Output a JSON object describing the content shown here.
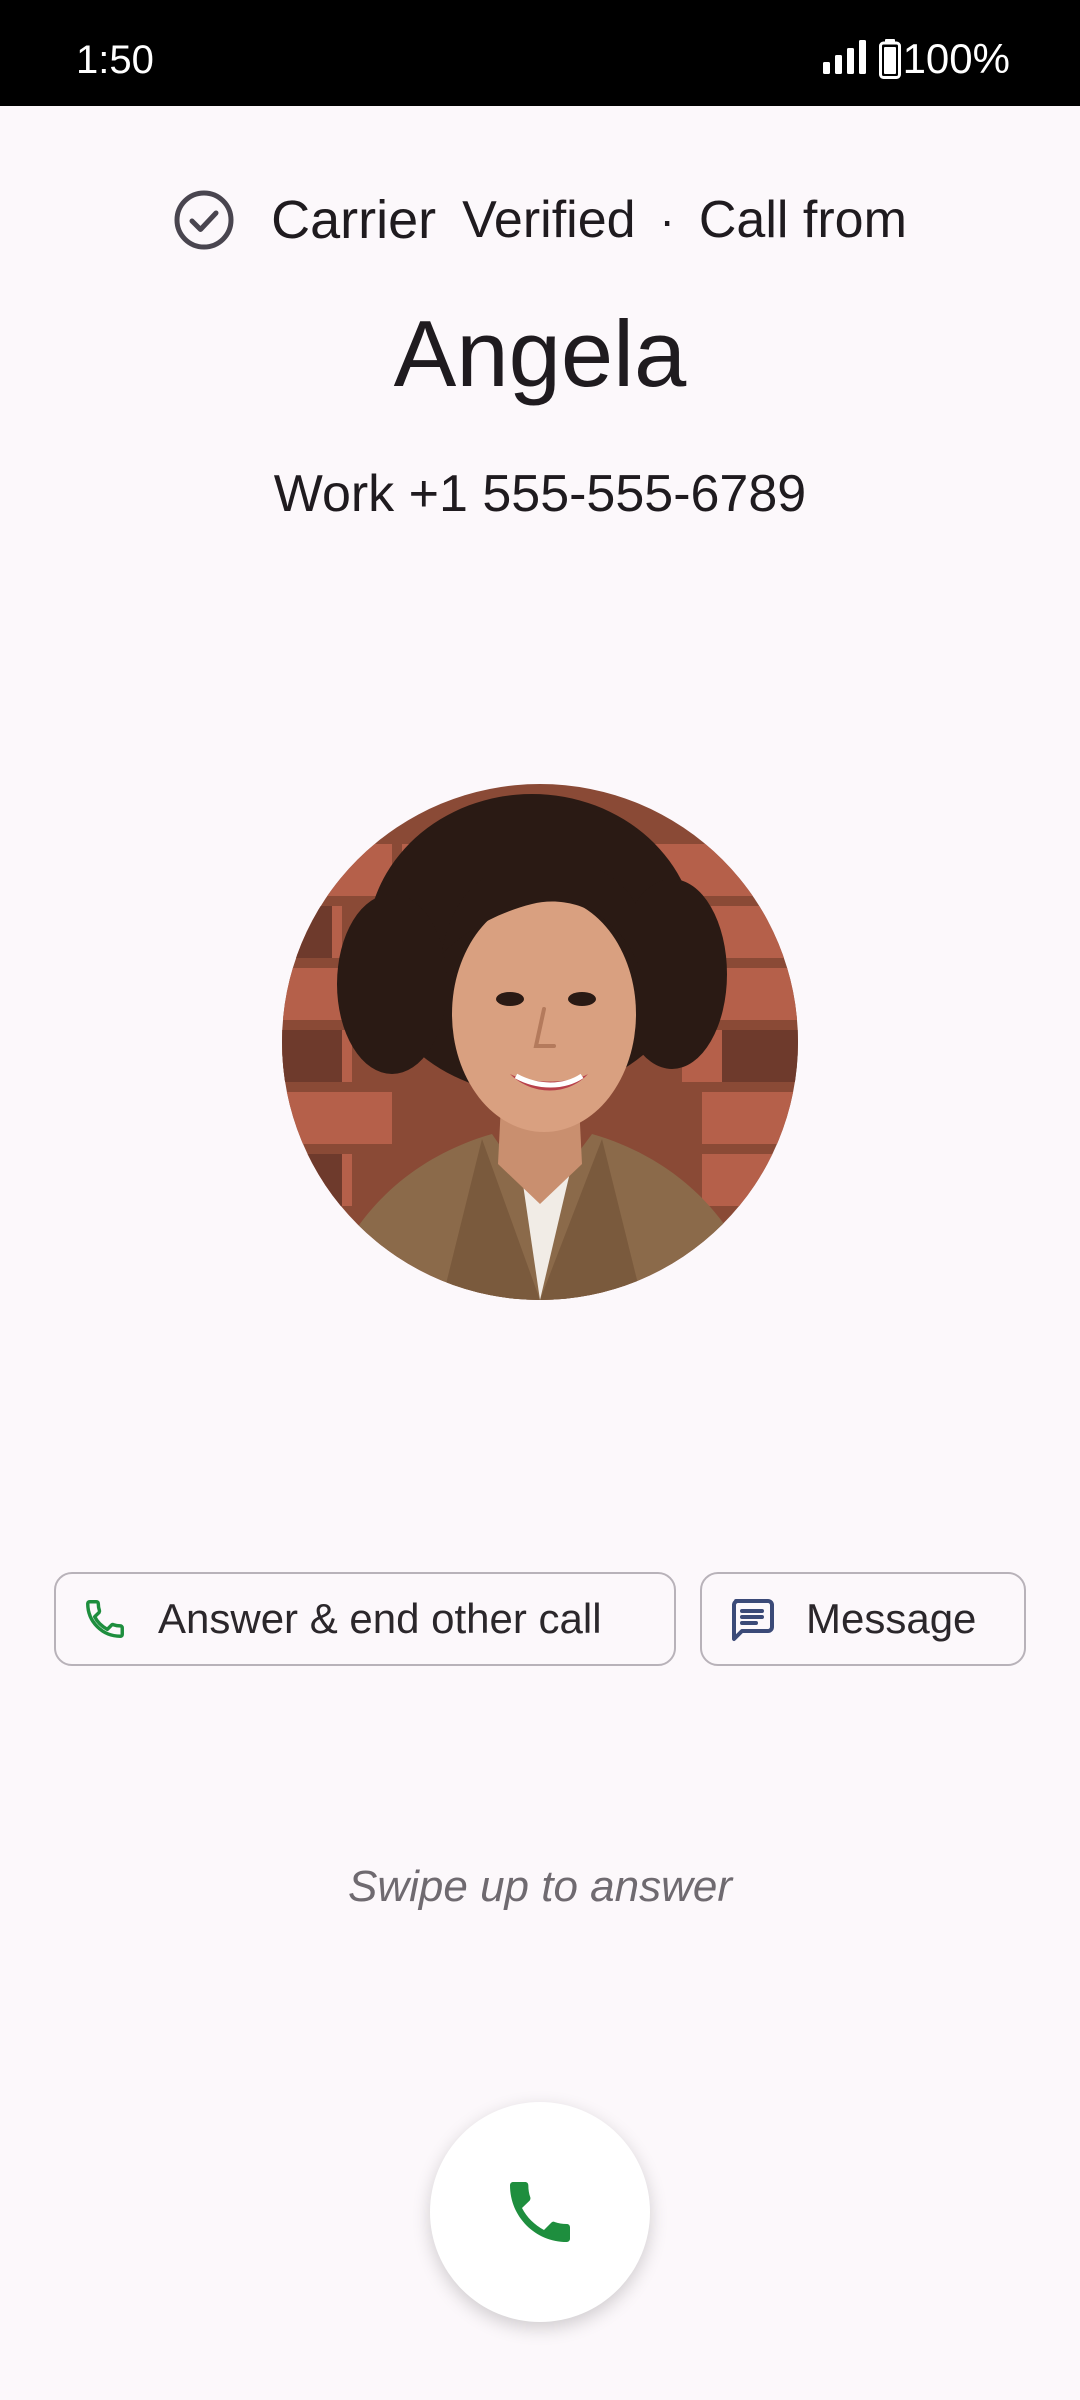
{
  "status_bar": {
    "time": "1:50",
    "battery": "100%",
    "icons": [
      "signal-icon",
      "battery-icon"
    ]
  },
  "header": {
    "verified_icon": "check-circle-icon",
    "carrier_label": "Carrier",
    "verified_label": "Verified",
    "separator": "·",
    "call_from_label": "Call from"
  },
  "caller": {
    "name": "Angela",
    "number": "Work +1 555-555-6789"
  },
  "actions": {
    "answer_end_label": "Answer & end other call",
    "message_label": "Message"
  },
  "swipe_hint": "Swipe up to answer",
  "colors": {
    "background": "#fcf8fb",
    "answer_green": "#1e8e3e",
    "message_blue": "#3b4a78"
  }
}
